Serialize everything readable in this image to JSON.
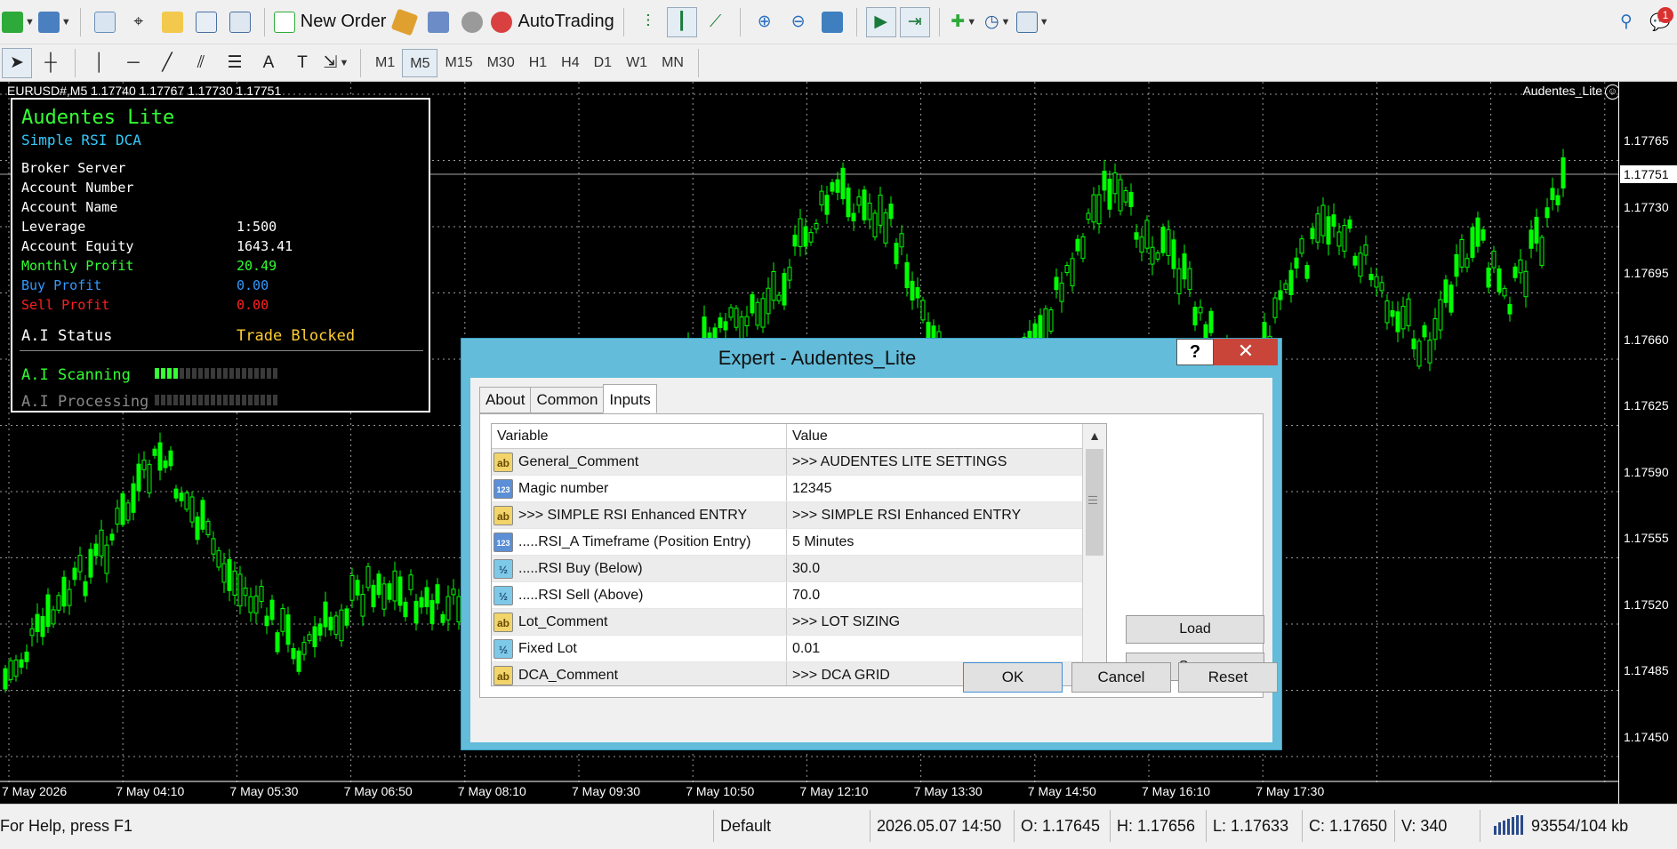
{
  "toolbar": {
    "new_order": "New Order",
    "autotrading": "AutoTrading",
    "timeframes": [
      "M1",
      "M5",
      "M15",
      "M30",
      "H1",
      "H4",
      "D1",
      "W1",
      "MN"
    ],
    "active_timeframe": "M5",
    "notification_count": "1"
  },
  "chart": {
    "title": "EURUSD#,M5  1.17740 1.17767 1.17730 1.17751",
    "ea_name": "Audentes_Lite",
    "current_price": "1.17751",
    "price_labels": [
      "1.17765",
      "1.17730",
      "1.17695",
      "1.17660",
      "1.17625",
      "1.17590",
      "1.17555",
      "1.17520",
      "1.17485",
      "1.17450"
    ],
    "time_labels": [
      "7 May 2026",
      "7 May 04:10",
      "7 May 05:30",
      "7 May 06:50",
      "7 May 08:10",
      "7 May 09:30",
      "7 May 10:50",
      "7 May 12:10",
      "7 May 13:30",
      "7 May 14:50",
      "7 May 16:10",
      "7 May 17:30"
    ],
    "colors": {
      "background": "#000000",
      "candle": "#00ff00",
      "grid": "#ffffff"
    }
  },
  "panel": {
    "title": "Audentes Lite",
    "subtitle": "Simple RSI DCA",
    "broker_server_label": "Broker Server",
    "account_number_label": "Account Number",
    "account_name_label": "Account Name",
    "leverage_label": "Leverage",
    "leverage_value": "1:500",
    "equity_label": "Account Equity",
    "equity_value": "1643.41",
    "monthly_profit_label": "Monthly Profit",
    "monthly_profit_value": "20.49",
    "buy_profit_label": "Buy Profit",
    "buy_profit_value": "0.00",
    "sell_profit_label": "Sell Profit",
    "sell_profit_value": "0.00",
    "ai_status_label": "A.I Status",
    "ai_status_value": "Trade Blocked",
    "ai_scanning_label": "A.I Scanning",
    "ai_processing_label": "A.I Processing",
    "scanning_level": 0.2,
    "processing_level": 0.0,
    "colors": {
      "title": "#33ff33",
      "subtitle": "#33ccff",
      "monthly": "#33ff33",
      "buy": "#3399ff",
      "sell": "#ff2020",
      "status": "#ffcc33"
    }
  },
  "dialog": {
    "title": "Expert - Audentes_Lite",
    "help": "?",
    "close": "✕",
    "tabs": [
      "About",
      "Common",
      "Inputs"
    ],
    "active_tab": "Inputs",
    "columns": [
      "Variable",
      "Value"
    ],
    "rows": [
      {
        "icon": "ab",
        "variable": "General_Comment",
        "value": ">>> AUDENTES LITE SETTINGS"
      },
      {
        "icon": "123",
        "variable": "Magic number",
        "value": "12345"
      },
      {
        "icon": "ab",
        "variable": ">>> SIMPLE RSI Enhanced ENTRY",
        "value": ">>> SIMPLE RSI Enhanced ENTRY"
      },
      {
        "icon": "123",
        "variable": ".....RSI_A Timeframe (Position Entry)",
        "value": "5 Minutes"
      },
      {
        "icon": "½",
        "variable": ".....RSI Buy (Below)",
        "value": "30.0"
      },
      {
        "icon": "½",
        "variable": ".....RSI Sell (Above)",
        "value": "70.0"
      },
      {
        "icon": "ab",
        "variable": "Lot_Comment",
        "value": ">>> LOT SIZING"
      },
      {
        "icon": "½",
        "variable": "Fixed Lot",
        "value": "0.01"
      },
      {
        "icon": "ab",
        "variable": "DCA_Comment",
        "value": ">>> DCA GRID"
      }
    ],
    "load": "Load",
    "save": "Save",
    "ok": "OK",
    "cancel": "Cancel",
    "reset": "Reset"
  },
  "status": {
    "help": "For Help, press F1",
    "profile": "Default",
    "datetime": "2026.05.07 14:50",
    "open": "O: 1.17645",
    "high": "H: 1.17656",
    "low": "L: 1.17633",
    "close": "C: 1.17650",
    "volume": "V: 340",
    "traffic": "93554/104 kb"
  }
}
